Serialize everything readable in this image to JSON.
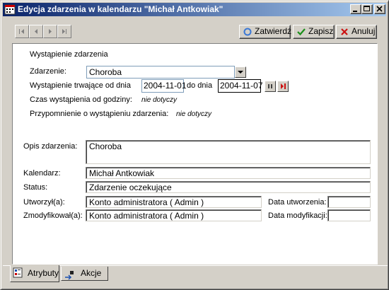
{
  "window": {
    "title": "Edycja zdarzenia w kalendarzu \"Michał Antkowiak\"",
    "icons": [
      "app-calendar-icon",
      "minimize-icon",
      "maximize-icon",
      "close-icon"
    ]
  },
  "toolbar": {
    "nav_icons": [
      "first-record-icon",
      "previous-record-icon",
      "next-record-icon",
      "last-record-icon"
    ],
    "confirm_label": "Zatwierdź",
    "save_label": "Zapisz",
    "cancel_label": "Anuluj"
  },
  "form": {
    "section_title": "Wystąpienie zdarzenia",
    "event_label": "Zdarzenie:",
    "event_value": "Choroba",
    "duration_label": "Wystąpienie trwające od dnia",
    "date_from": "2004-11-01",
    "to_label": "do dnia",
    "date_to": "2004-11-07",
    "time_label": "Czas wystąpienia od godziny:",
    "time_value": "nie dotyczy",
    "reminder_label": "Przypomnienie o wystąpieniu zdarzenia:",
    "reminder_value": "nie dotyczy",
    "description_label": "Opis zdarzenia:",
    "description_value": "Choroba",
    "calendar_label": "Kalendarz:",
    "calendar_value": "Michał Antkowiak",
    "status_label": "Status:",
    "status_value": "Zdarzenie oczekujące",
    "created_by_label": "Utworzył(a):",
    "created_by_value": "Konto administratora ( Admin )",
    "created_date_label": "Data utworzenia:",
    "created_date_value": "",
    "modified_by_label": "Zmodyfikował(a):",
    "modified_by_value": "Konto administratora ( Admin )",
    "modified_date_label": "Data modyfikacji:",
    "modified_date_value": ""
  },
  "tabs": [
    {
      "label": "Atrybuty",
      "active": true
    },
    {
      "label": "Akcje",
      "active": false
    }
  ],
  "colors": {
    "title_gradient_start": "#0a246a",
    "title_gradient_end": "#a6caf0",
    "face": "#d4d0c8",
    "confirm_icon": "#3a78d6",
    "save_icon": "#1a8f1a",
    "cancel_icon": "#cc1111"
  }
}
